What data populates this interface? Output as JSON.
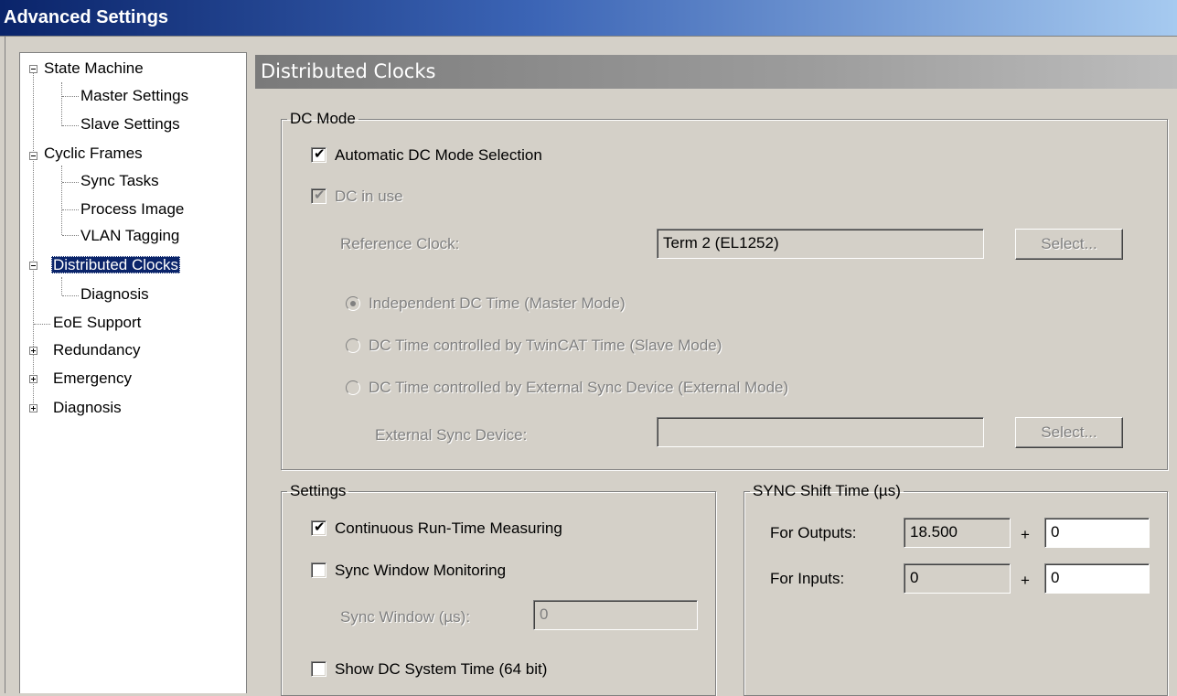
{
  "window": {
    "title": "Advanced Settings"
  },
  "tree": {
    "state_machine": "State Machine",
    "master_settings": "Master Settings",
    "slave_settings": "Slave Settings",
    "cyclic_frames": "Cyclic Frames",
    "sync_tasks": "Sync Tasks",
    "process_image": "Process Image",
    "vlan_tagging": "VLAN Tagging",
    "distributed_clocks": "Distributed Clocks",
    "diagnosis_child": "Diagnosis",
    "eoe_support": "EoE Support",
    "redundancy": "Redundancy",
    "emergency": "Emergency",
    "diagnosis": "Diagnosis"
  },
  "page": {
    "title": "Distributed Clocks"
  },
  "dc_mode": {
    "legend": "DC Mode",
    "auto_selection": "Automatic DC Mode Selection",
    "auto_selection_checked": true,
    "dc_in_use": "DC in use",
    "dc_in_use_checked": true,
    "reference_clock_label": "Reference Clock:",
    "reference_clock_value": "Term 2 (EL1252)",
    "select_label": "Select...",
    "radio_independent": "Independent DC Time (Master Mode)",
    "radio_twincat": "DC Time controlled by TwinCAT Time (Slave Mode)",
    "radio_external": "DC Time controlled by External Sync Device (External Mode)",
    "selected_mode": "Independent DC Time (Master Mode)",
    "external_sync_label": "External Sync Device:",
    "external_sync_value": "",
    "select_label_2": "Select..."
  },
  "settings": {
    "legend": "Settings",
    "continuous": "Continuous Run-Time Measuring",
    "continuous_checked": true,
    "sync_window_monitoring": "Sync Window Monitoring",
    "sync_window_monitoring_checked": false,
    "sync_window_label": "Sync Window (µs):",
    "sync_window_value": "0",
    "show_dc_time": "Show DC System Time (64 bit)",
    "show_dc_time_checked": false
  },
  "sync_shift": {
    "legend": "SYNC Shift Time (µs)",
    "outputs_label": "For Outputs:",
    "outputs_value": "18.500",
    "outputs_offset": "0",
    "inputs_label": "For Inputs:",
    "inputs_value": "0",
    "inputs_offset": "0",
    "plus": "+"
  }
}
